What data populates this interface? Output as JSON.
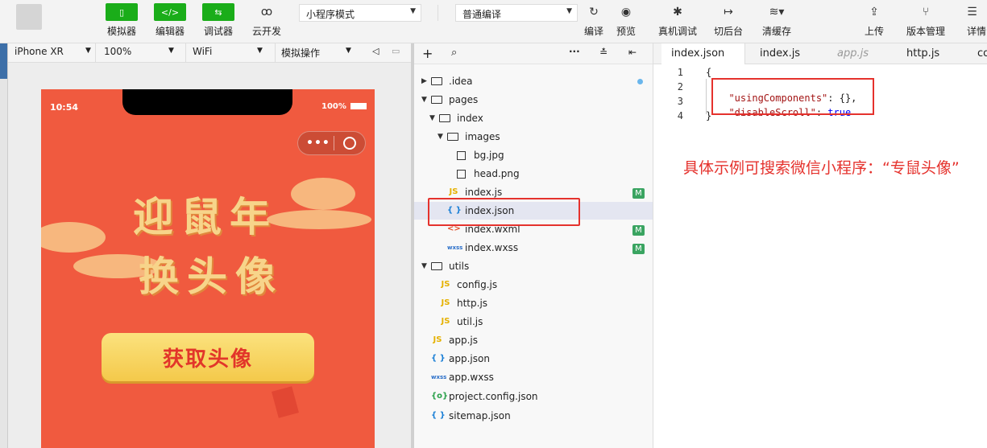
{
  "toolbar": {
    "simulator_label": "模拟器",
    "editor_label": "编辑器",
    "debugger_label": "调试器",
    "cloud_dev_label": "云开发",
    "mode_select": "小程序模式",
    "compile_select": "普通编译",
    "compile_label": "编译",
    "preview_label": "预览",
    "real_debug_label": "真机调试",
    "background_label": "切后台",
    "clear_cache_label": "清缓存",
    "upload_label": "上传",
    "version_label": "版本管理",
    "details_label": "详情"
  },
  "simulator": {
    "device": "iPhone XR",
    "zoom": "100%",
    "network": "WiFi",
    "operation": "模拟操作",
    "phone": {
      "time": "10:54",
      "battery": "100%",
      "title_line1": "迎鼠年",
      "title_line2": "换头像",
      "button_label": "获取头像"
    }
  },
  "explorer": {
    "items": [
      {
        "name": ".idea",
        "type": "folder"
      },
      {
        "name": "pages",
        "type": "folder"
      },
      {
        "name": "index",
        "type": "folder"
      },
      {
        "name": "images",
        "type": "folder"
      },
      {
        "name": "bg.jpg",
        "type": "image"
      },
      {
        "name": "head.png",
        "type": "image"
      },
      {
        "name": "index.js",
        "type": "js",
        "badge": "M"
      },
      {
        "name": "index.json",
        "type": "json",
        "selected": true
      },
      {
        "name": "index.wxml",
        "type": "wxml",
        "badge": "M"
      },
      {
        "name": "index.wxss",
        "type": "wxss",
        "badge": "M"
      },
      {
        "name": "utils",
        "type": "folder"
      },
      {
        "name": "config.js",
        "type": "js"
      },
      {
        "name": "http.js",
        "type": "js"
      },
      {
        "name": "util.js",
        "type": "js"
      },
      {
        "name": "app.js",
        "type": "js"
      },
      {
        "name": "app.json",
        "type": "json"
      },
      {
        "name": "app.wxss",
        "type": "wxss"
      },
      {
        "name": "project.config.json",
        "type": "config"
      },
      {
        "name": "sitemap.json",
        "type": "json"
      }
    ]
  },
  "editor": {
    "tabs": [
      "index.json",
      "index.js",
      "app.js",
      "http.js",
      "co"
    ],
    "line_numbers": [
      "1",
      "2",
      "3",
      "4"
    ],
    "code": {
      "line1": "{",
      "key1": "\"usingComponents\"",
      "val1": ": {},",
      "key2": "\"disableScroll\"",
      "colon2": ": ",
      "val2": "true",
      "line4": "}"
    },
    "annotation": "具体示例可搜索微信小程序：“专鼠头像”"
  },
  "colors": {
    "accent_green": "#1aad19",
    "highlight_red": "#e5322d",
    "phone_bg": "#f05a3f"
  }
}
